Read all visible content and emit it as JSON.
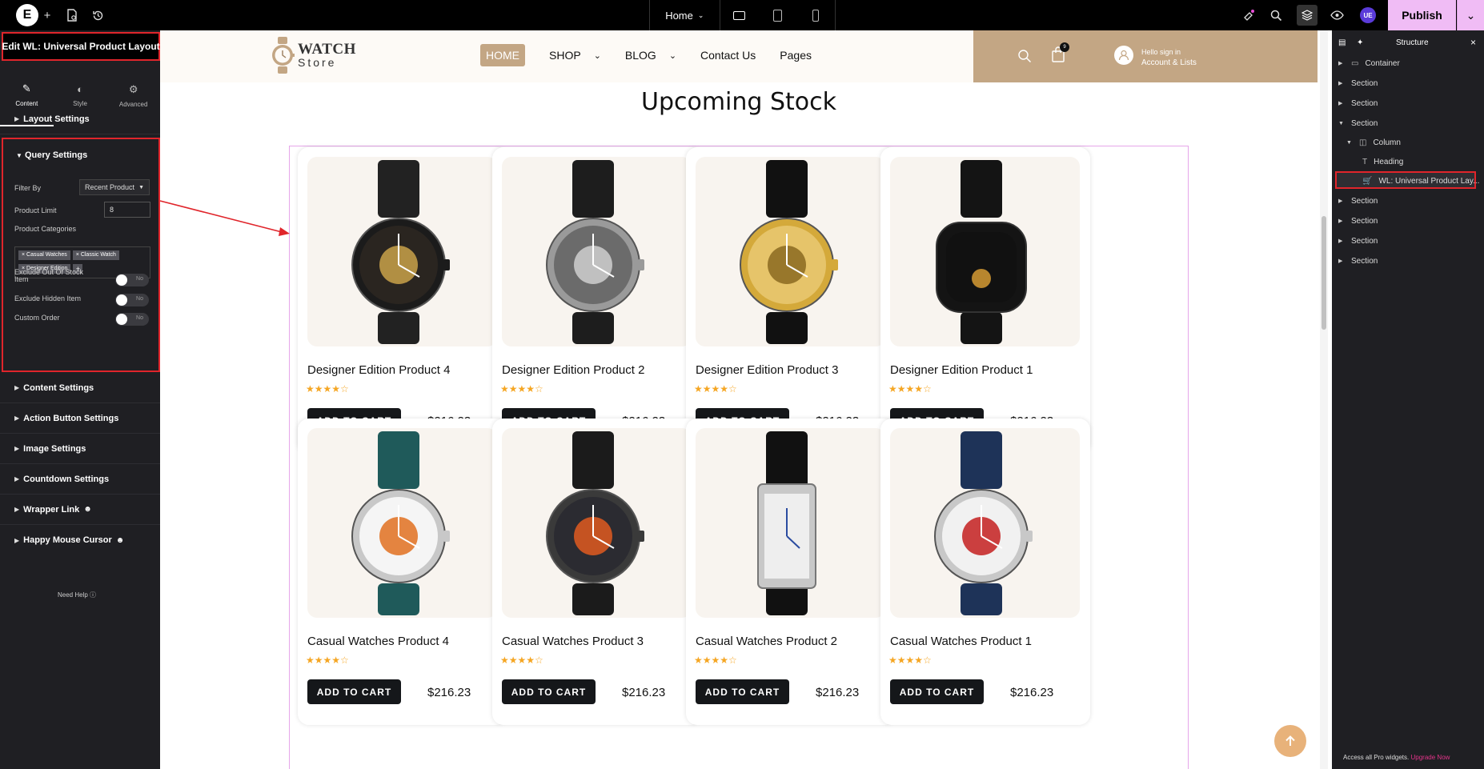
{
  "topbar": {
    "page_label": "Home",
    "publish_label": "Publish",
    "user_initials": "UE"
  },
  "left_panel": {
    "title": "Edit WL: Universal Product Layout",
    "tabs": [
      {
        "label": "Content",
        "icon": "pencil-icon"
      },
      {
        "label": "Style",
        "icon": "contrast-icon"
      },
      {
        "label": "Advanced",
        "icon": "gear-icon"
      }
    ],
    "sections_top": [
      "Layout Settings"
    ],
    "query": {
      "title": "Query Settings",
      "filter_label": "Filter By",
      "filter_value": "Recent Product",
      "limit_label": "Product Limit",
      "limit_value": "8",
      "categories_label": "Product Categories",
      "categories": [
        "Casual Watches",
        "Classic Watch",
        "Designer Edition"
      ],
      "toggles": [
        {
          "label": "Exclude Out Of Stock Item",
          "value": "No"
        },
        {
          "label": "Exclude Hidden Item",
          "value": "No"
        },
        {
          "label": "Custom Order",
          "value": "No"
        }
      ]
    },
    "sections_bottom": [
      "Content Settings",
      "Action Button Settings",
      "Image Settings",
      "Countdown Settings",
      "Wrapper Link",
      "Happy Mouse Cursor"
    ],
    "need_help": "Need Help"
  },
  "site": {
    "logo_line1": "WATCH",
    "logo_line2": "Store",
    "nav": [
      "HOME",
      "SHOP",
      "BLOG",
      "Contact Us",
      "Pages"
    ],
    "cart_count": "9",
    "account_line1": "Hello sign in",
    "account_line2": "Account & Lists",
    "section_title": "Upcoming Stock",
    "add_to_cart": "ADD TO CART",
    "products": [
      {
        "name": "Designer Edition Product 4",
        "price": "$216.23",
        "rating": 4
      },
      {
        "name": "Designer Edition Product 2",
        "price": "$216.23",
        "rating": 4
      },
      {
        "name": "Designer Edition Product 3",
        "price": "$216.23",
        "rating": 4
      },
      {
        "name": "Designer Edition Product 1",
        "price": "$216.23",
        "rating": 4
      },
      {
        "name": "Casual Watches Product 4",
        "price": "$216.23",
        "rating": 4
      },
      {
        "name": "Casual Watches Product 3",
        "price": "$216.23",
        "rating": 4
      },
      {
        "name": "Casual Watches Product 2",
        "price": "$216.23",
        "rating": 4
      },
      {
        "name": "Casual Watches Product 1",
        "price": "$216.23",
        "rating": 4
      }
    ]
  },
  "structure": {
    "title": "Structure",
    "items": [
      {
        "label": "Container",
        "icon": "container-icon"
      },
      {
        "label": "Section"
      },
      {
        "label": "Section"
      },
      {
        "label": "Section"
      },
      {
        "label": "Column",
        "icon": "column-icon"
      },
      {
        "label": "Heading",
        "icon": "heading-icon"
      },
      {
        "label": "WL: Universal Product Lay...",
        "icon": "cart-icon"
      },
      {
        "label": "Section"
      },
      {
        "label": "Section"
      },
      {
        "label": "Section"
      },
      {
        "label": "Section"
      }
    ],
    "footer_text": "Access all Pro widgets.",
    "footer_link": "Upgrade Now"
  },
  "colors": {
    "accent_tan": "#c3a684",
    "publish_pink": "#f0bcf5",
    "highlight_red": "#e0252b",
    "star_orange": "#f5a623",
    "panel_dark": "#1f1f23"
  }
}
